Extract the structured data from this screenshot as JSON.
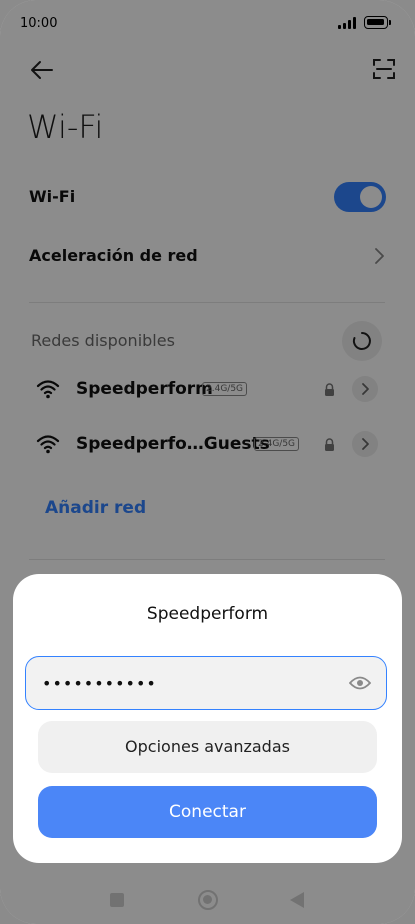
{
  "status_bar": {
    "time": "10:00"
  },
  "header": {
    "title": "Wi-Fi"
  },
  "settings": {
    "wifi_label": "Wi-Fi",
    "wifi_enabled": true,
    "acceleration_label": "Aceleración de red"
  },
  "networks": {
    "section_title": "Redes disponibles",
    "items": [
      {
        "name": "Speedperform",
        "band": "2.4G/5G",
        "secured": true
      },
      {
        "name": "Speedperfo…Guests",
        "band": "2.4G/5G",
        "secured": true
      }
    ],
    "add_label": "Añadir red"
  },
  "dialog": {
    "title": "Speedperform",
    "password_value": "•••••••••••",
    "advanced_label": "Opciones avanzadas",
    "connect_label": "Conectar"
  },
  "colors": {
    "accent": "#3482ff",
    "connect_button": "#4b86f7"
  }
}
